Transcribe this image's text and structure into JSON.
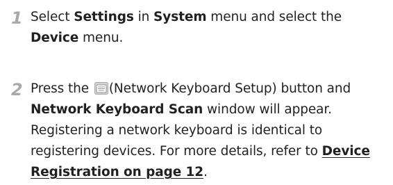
{
  "steps": [
    {
      "number": "1",
      "segments": {
        "t1": "Select ",
        "b1": "Settings",
        "t2": " in ",
        "b2": "System",
        "t3": " menu and select the ",
        "b3": "Device",
        "t4": " menu."
      }
    },
    {
      "number": "2",
      "segments": {
        "t1": "Press the ",
        "icon": "network-keyboard-setup-icon",
        "t2": "(Network Keyboard Setup) button and ",
        "b1": "Network Keyboard Scan",
        "t3": " window will appear. Registering a network keyboard is identical to registering devices. For more details, refer to ",
        "link": "Device Registration on page 12",
        "t4": "."
      }
    }
  ]
}
